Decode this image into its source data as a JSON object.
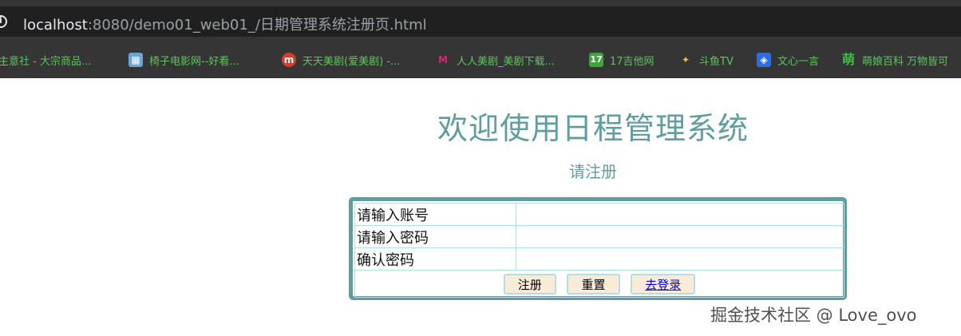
{
  "browser": {
    "url_host": "localhost",
    "url_rest": ":8080/demo01_web01_/日期管理系统注册页.html"
  },
  "bookmarks": [
    {
      "label": "主意社 - 大宗商品...",
      "icon": "none"
    },
    {
      "label": "椅子电影网--好看...",
      "icon": "film-icon"
    },
    {
      "label": "天天美剧(爱美剧) -...",
      "icon": "m-logo-icon"
    },
    {
      "label": "人人美剧_美剧下载...",
      "icon": "rr-logo-icon"
    },
    {
      "label": "17吉他网",
      "icon": "17-logo-icon"
    },
    {
      "label": "斗鱼TV",
      "icon": "douyu-logo-icon"
    },
    {
      "label": "文心一言",
      "icon": "wenxin-logo-icon"
    },
    {
      "label": "萌娘百科 万物皆可",
      "icon": "moegirl-logo-icon"
    }
  ],
  "page": {
    "title": "欢迎使用日程管理系统",
    "subtitle": "请注册",
    "form": {
      "account_label": "请输入账号",
      "account_value": "",
      "password_label": "请输入密码",
      "password_value": "",
      "confirm_label": "确认密码",
      "confirm_value": "",
      "register_button": "注册",
      "reset_button": "重置",
      "login_link": "去登录"
    },
    "watermark": "掘金技术社区 @ Love_ovo"
  },
  "colors": {
    "accent": "#5f9ea0",
    "table_border": "#b0e0e6",
    "button_bg": "#faebd7",
    "bookmark_text": "#5ec45e"
  }
}
